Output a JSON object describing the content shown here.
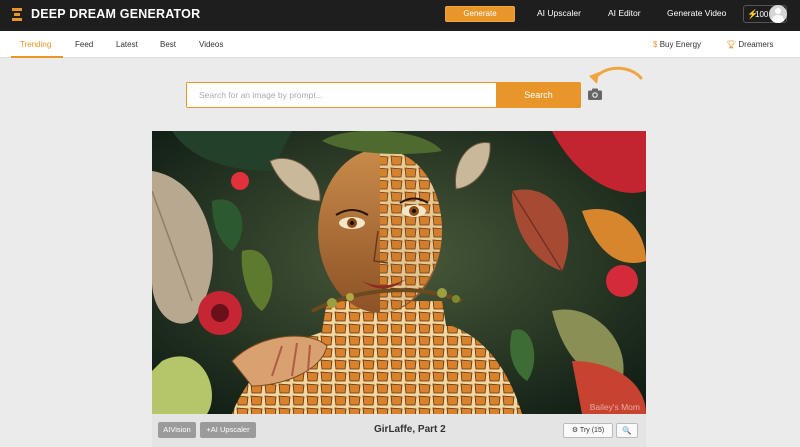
{
  "header": {
    "brand": "DEEP DREAM GENERATOR",
    "generate_label": "Generate",
    "nav": [
      "AI Upscaler",
      "AI Editor",
      "Generate Video"
    ],
    "energy_count": "100"
  },
  "subnav": {
    "tabs": [
      "Trending",
      "Feed",
      "Latest",
      "Best",
      "Videos"
    ],
    "active_tab": "Trending",
    "buy_energy": "Buy Energy",
    "dreamers": "Dreamers"
  },
  "search": {
    "placeholder": "Search for an image by prompt...",
    "value": "",
    "button_label": "Search"
  },
  "image_card": {
    "watermark": "Bailey's Mom",
    "tags": [
      "AIVision",
      "+AI Upscaler"
    ],
    "title": "GirLaffe, Part 2",
    "try_label": "Try (15)",
    "zoom_label": "🔍"
  },
  "icons": {
    "logo": "logo-icon",
    "energy": "bolt-icon",
    "buy_energy": "dollar-icon",
    "dreamers": "trophy-icon",
    "camera": "camera-icon",
    "arrow": "pointer-arrow-icon",
    "try": "gear-icon",
    "zoom": "search-icon"
  },
  "colors": {
    "accent": "#e8952a",
    "topbar": "#1e1e1e",
    "background": "#ebebeb"
  }
}
